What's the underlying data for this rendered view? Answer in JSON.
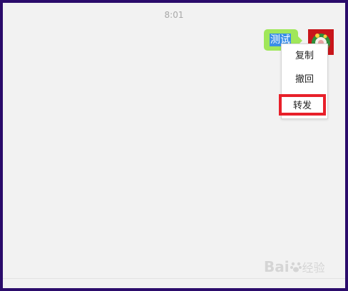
{
  "chat": {
    "timestamp": "8:01",
    "message_text": "测试"
  },
  "context_menu": {
    "items": [
      {
        "label": "复制"
      },
      {
        "label": "撤回"
      },
      {
        "label": "转发"
      }
    ],
    "highlight_color": "#e8202a"
  },
  "colors": {
    "frame_border": "#2b0c6b",
    "chat_background": "#f2f2f2",
    "bubble": "#a0e75a",
    "selection": "#3a8ee6"
  },
  "avatar": {
    "icon": "wreath-avatar-icon"
  },
  "watermark": {
    "brand": "Bai",
    "suffix": "经验"
  }
}
